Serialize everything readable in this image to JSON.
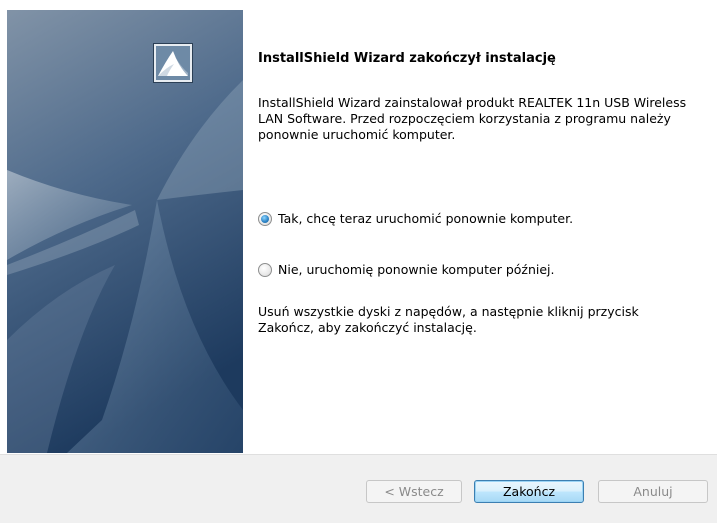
{
  "wizard": {
    "title": "InstallShield Wizard zakończył instalację",
    "description": "InstallShield Wizard zainstalował produkt REALTEK 11n USB Wireless LAN Software. Przed rozpoczęciem korzystania z programu należy ponownie uruchomić komputer.",
    "options": [
      {
        "label": "Tak, chcę teraz uruchomić ponownie komputer.",
        "selected": true
      },
      {
        "label": "Nie, uruchomię ponownie komputer później.",
        "selected": false
      }
    ],
    "note": "Usuń wszystkie dyski z napędów, a następnie kliknij przycisk Zakończ, aby zakończyć instalację."
  },
  "buttons": {
    "back": "< Wstecz",
    "finish": "Zakończ",
    "cancel": "Anuluj"
  },
  "colors": {
    "banner_top": "#7f93a8",
    "banner_bottom": "#1f3e63",
    "accent": "#3c7fb1"
  },
  "icons": {
    "logo": "installshield-logo-icon"
  }
}
